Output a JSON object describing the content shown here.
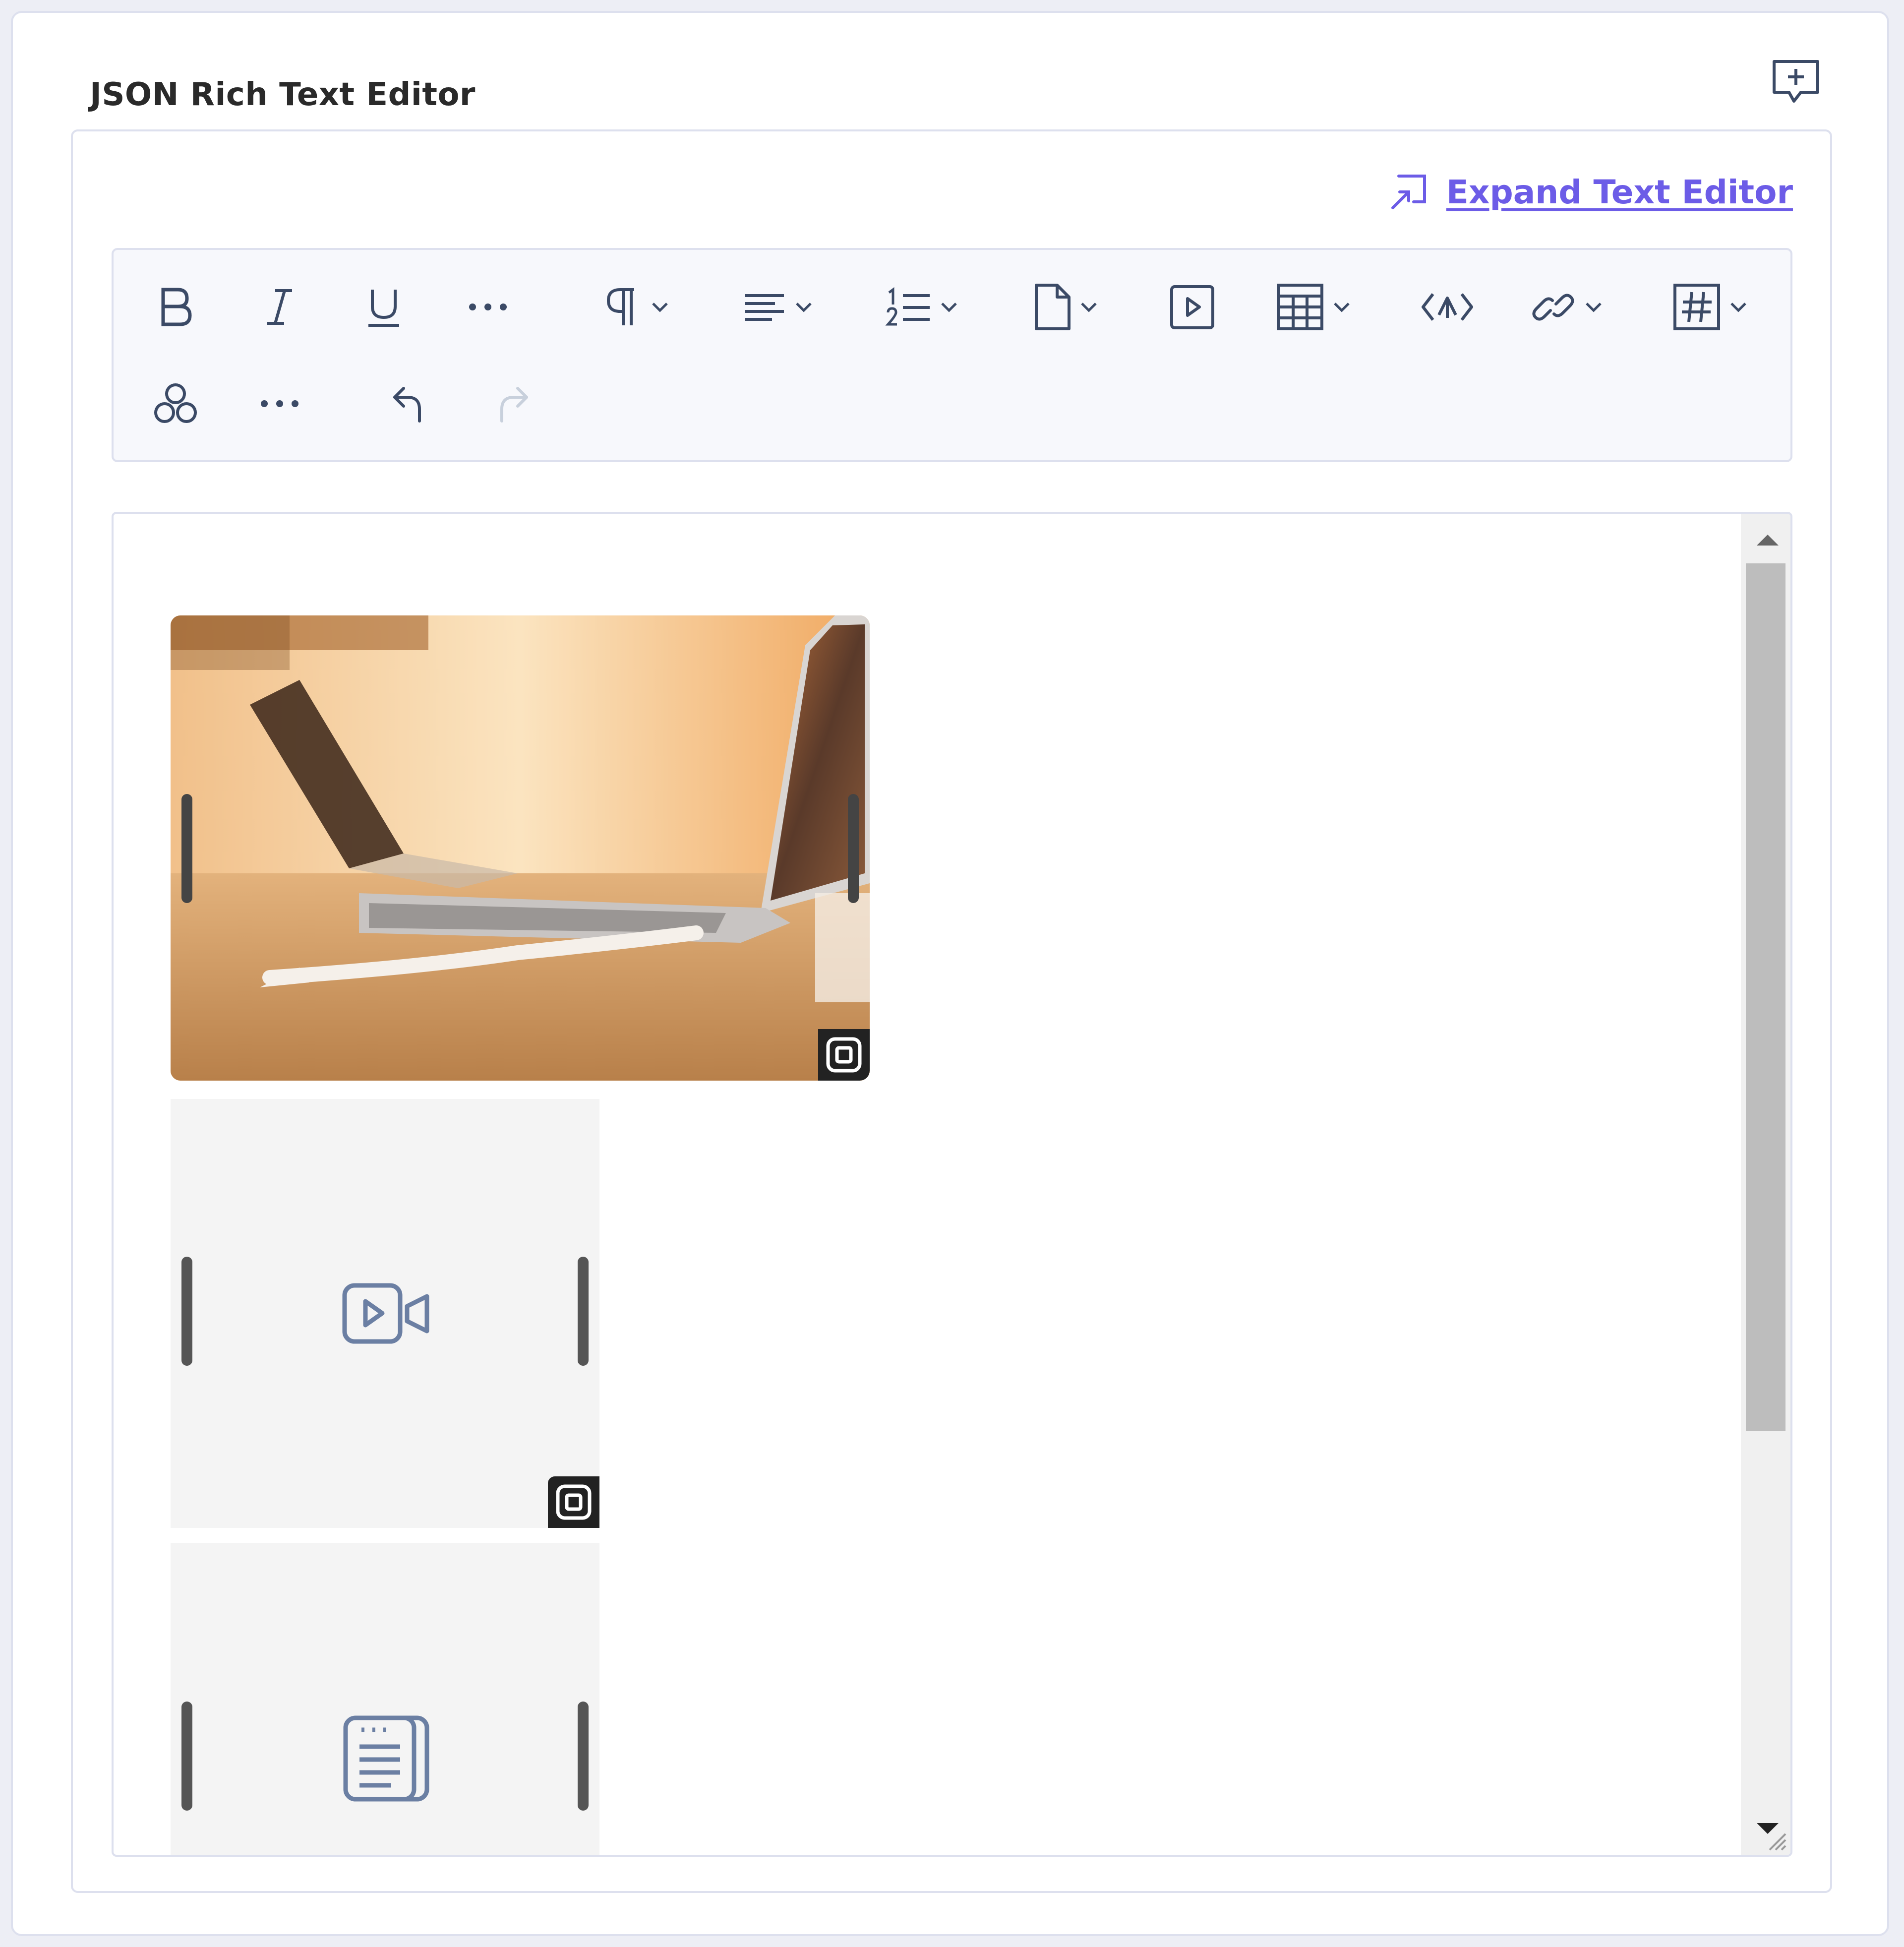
{
  "field": {
    "title": "JSON Rich Text Editor"
  },
  "editor": {
    "expand_label": "Expand Text Editor"
  },
  "toolbar": {
    "icons": [
      "bold-icon",
      "italic-icon",
      "underline-icon",
      "more-icon",
      "paragraph-icon",
      "align-icon",
      "ordered-list-icon",
      "file-icon",
      "video-icon",
      "table-icon",
      "code-embed-icon",
      "link-icon",
      "hashtag-icon",
      "properties-icon",
      "more-icon",
      "undo-icon",
      "redo-icon"
    ],
    "redo_enabled": false
  },
  "colors": {
    "accent": "#6c5ce7",
    "icon": "#3b4a66",
    "embed_icon": "#6b7fa3"
  },
  "content": {
    "blocks": [
      "image",
      "video",
      "reference"
    ]
  }
}
